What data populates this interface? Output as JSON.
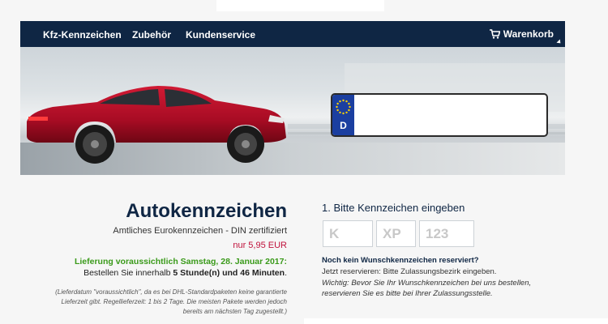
{
  "nav": {
    "items": [
      "Kfz-Kennzeichen",
      "Zubehör",
      "Kundenservice"
    ],
    "cart_label": "Warenkorb"
  },
  "hero": {
    "plate_country": "D",
    "car_color": "#b0102a"
  },
  "product": {
    "title": "Autokennzeichen",
    "subtitle": "Amtliches Eurokennzeichen - DIN zertifiziert",
    "price": "nur 5,95 EUR",
    "delivery": "Lieferung voraussichtlich Samstag, 28. Januar 2017:",
    "order_prefix": "Bestellen Sie innerhalb ",
    "order_time": "5 Stunde(n) und 46 Minuten",
    "order_suffix": ".",
    "note": "(Lieferdatum \"voraussichtlich\", da es bei DHL-Standardpaketen keine garantierte Lieferzeit gibt. Regellieferzeit: 1 bis 2 Tage. Die meisten Pakete werden jedoch bereits am nächsten Tag zugestellt.)"
  },
  "plate_form": {
    "step_label": "1. Bitte Kennzeichen eingeben",
    "field1_placeholder": "K",
    "field2_placeholder": "XP",
    "field3_placeholder": "123",
    "question": "Noch kein Wunschkennzeichen reserviert?",
    "info1": "Jetzt reservieren: Bitte Zulassungsbezirk eingeben.",
    "info2": "Wichtig: Bevor Sie Ihr Wunschkennzeichen bei uns bestellen, reservieren Sie es bitte bei Ihrer Zulassungsstelle."
  },
  "colors": {
    "navy": "#0f2644",
    "price_red": "#c0123c",
    "delivery_green": "#3a9a1a",
    "eu_blue": "#1b3fa0"
  }
}
